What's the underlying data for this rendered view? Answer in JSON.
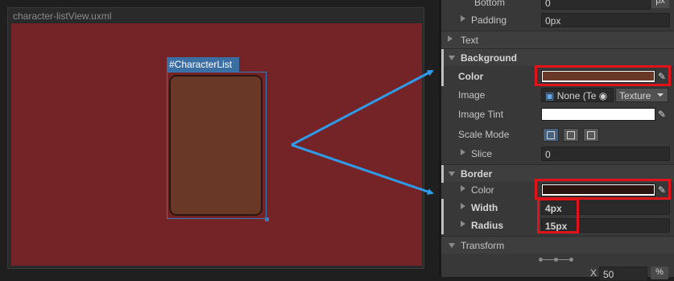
{
  "viewport": {
    "title": "character-listView.uxml",
    "element_tag": "#CharacterList",
    "canvas_color": "#742326",
    "element_bg_color": "#6a3826",
    "element_border_color": "#2b1511"
  },
  "inspector": {
    "bottom": {
      "label": "Bottom",
      "value": "0",
      "unit": "px"
    },
    "padding": {
      "label": "Padding",
      "value": "0px"
    },
    "text_section": "Text",
    "background": {
      "header": "Background",
      "color_label": "Color",
      "color_value": "#6a3826",
      "image_label": "Image",
      "image_value": "None (Te",
      "image_type": "Texture",
      "tint_label": "Image Tint",
      "tint_value": "#ffffff",
      "scale_mode_label": "Scale Mode",
      "slice_label": "Slice",
      "slice_value": "0"
    },
    "border": {
      "header": "Border",
      "color_label": "Color",
      "color_value": "#2b1511",
      "width_label": "Width",
      "width_value": "4px",
      "radius_label": "Radius",
      "radius_value": "15px"
    },
    "transform": {
      "header": "Transform",
      "x_label": "X",
      "x_value": "50",
      "x_unit": "%"
    }
  },
  "colors": {
    "highlight": "#e0121a",
    "arrow": "#2f9be8",
    "selection": "#3b78b8"
  }
}
